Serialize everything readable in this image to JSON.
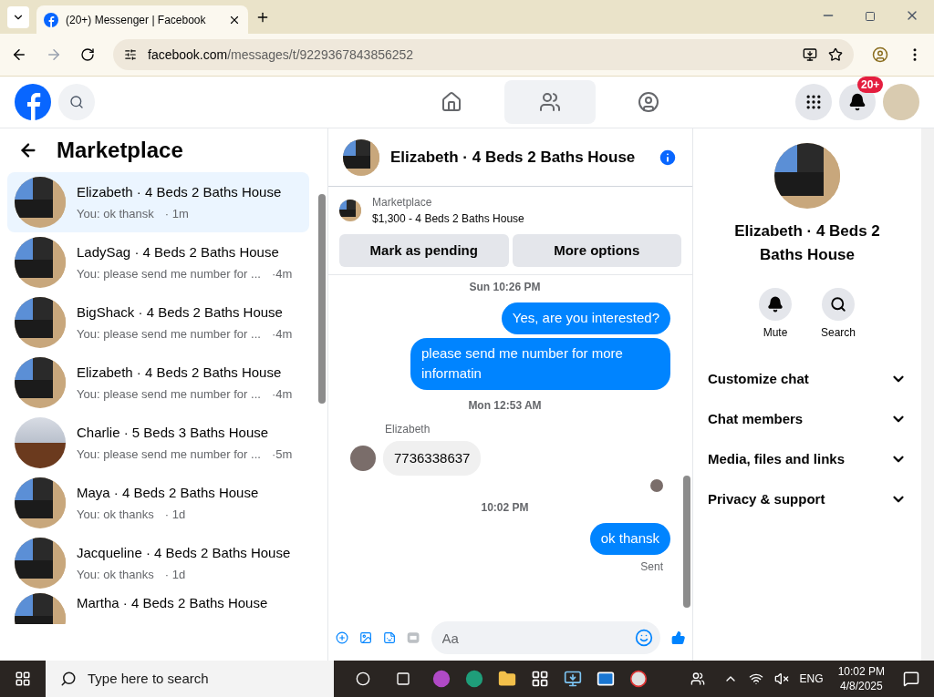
{
  "browser": {
    "tab_title": "(20+) Messenger | Facebook",
    "url_host": "facebook.com",
    "url_path": "/messages/t/9229367843856252"
  },
  "top_nav": {
    "tabs": [
      {
        "kind": "home",
        "selected": false
      },
      {
        "kind": "friends",
        "selected": true
      },
      {
        "kind": "groups",
        "selected": false
      }
    ],
    "notification_badge": "20+"
  },
  "sidebar": {
    "title": "Marketplace",
    "conversations": [
      {
        "name": "Elizabeth · 4 Beds 2 Baths House",
        "snippet": "You: ok thansk",
        "time": "· 1m",
        "selected": true
      },
      {
        "name": "LadySag · 4 Beds 2 Baths House",
        "snippet": "You: please send me number for ...",
        "time": "·4m",
        "selected": false
      },
      {
        "name": "BigShack · 4 Beds 2 Baths House",
        "snippet": "You: please send me number for ...",
        "time": "·4m",
        "selected": false
      },
      {
        "name": "Elizabeth · 4 Beds 2 Baths House",
        "snippet": "You: please send me number for ...",
        "time": "·4m",
        "selected": false
      },
      {
        "name": "Charlie · 5 Beds 3 Baths House",
        "snippet": "You: please send me number for ...",
        "time": "·5m",
        "selected": false
      },
      {
        "name": "Maya · 4 Beds 2 Baths House",
        "snippet": "You: ok thanks",
        "time": "· 1d",
        "selected": false
      },
      {
        "name": "Jacqueline · 4 Beds 2 Baths House",
        "snippet": "You: ok thanks",
        "time": "· 1d",
        "selected": false
      },
      {
        "name": "Martha · 4 Beds 2 Baths House",
        "selected": false
      }
    ]
  },
  "chat": {
    "title": "Elizabeth · 4 Beds 2 Baths House",
    "listing": {
      "label": "Marketplace",
      "price_title": "$1,300 - 4 Beds 2 Baths House"
    },
    "actions": [
      "Mark as pending",
      "More options"
    ],
    "messages": [
      {
        "kind": "time",
        "text": "Sun 10:26 PM"
      },
      {
        "kind": "out",
        "text": "Yes, are you interested?"
      },
      {
        "kind": "out",
        "text": "please send me number for more informatin"
      },
      {
        "kind": "time",
        "text": "Mon 12:53 AM"
      },
      {
        "kind": "in",
        "sender": "Elizabeth",
        "text": "7736338637"
      },
      {
        "kind": "seen"
      },
      {
        "kind": "time",
        "text": "10:02 PM"
      },
      {
        "kind": "out",
        "text": "ok thansk"
      },
      {
        "kind": "status",
        "text": "Sent"
      }
    ],
    "composer": {
      "placeholder": "Aa"
    }
  },
  "details": {
    "title": "Elizabeth · 4 Beds 2 Baths House",
    "buttons": [
      {
        "kind": "mute",
        "label": "Mute"
      },
      {
        "kind": "search",
        "label": "Search"
      }
    ],
    "sections": [
      "Customize chat",
      "Chat members",
      "Media, files and links",
      "Privacy & support"
    ]
  },
  "taskbar": {
    "search_placeholder": "Type here to search",
    "language": "ENG",
    "time": "10:02 PM",
    "date": "4/8/2025"
  }
}
